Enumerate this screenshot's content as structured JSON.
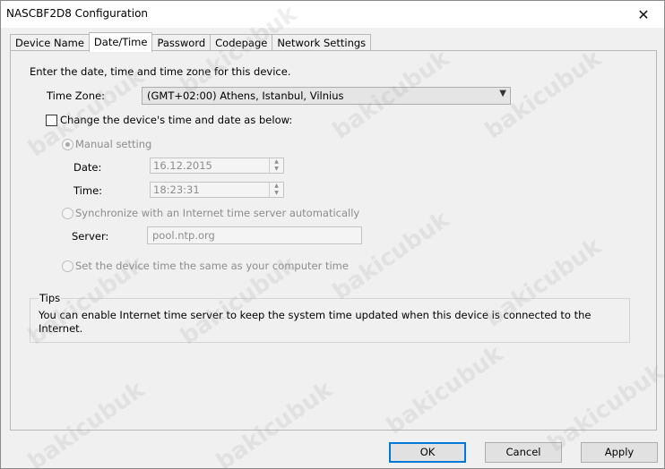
{
  "window": {
    "title": "NASCBF2D8 Configuration",
    "close_glyph": "✕"
  },
  "tabs": [
    {
      "label": "Device Name",
      "active": false
    },
    {
      "label": "Date/Time",
      "active": true
    },
    {
      "label": "Password",
      "active": false
    },
    {
      "label": "Codepage",
      "active": false
    },
    {
      "label": "Network Settings",
      "active": false
    }
  ],
  "content": {
    "intro": "Enter the date, time and time zone for this device.",
    "timezone_label": "Time Zone:",
    "timezone_value": "(GMT+02:00) Athens, Istanbul, Vilnius",
    "change_checkbox_label": "Change the device's time and date as below:",
    "change_checked": false,
    "manual_label": "Manual setting",
    "date_label": "Date:",
    "date_value": "16.12.2015",
    "time_label": "Time:",
    "time_value": "18:23:31",
    "sync_label": "Synchronize with an Internet time server automatically",
    "server_label": "Server:",
    "server_value": "pool.ntp.org",
    "same_label": "Set the device time the same as your computer time",
    "tips_title": "Tips",
    "tips_text": "You can enable Internet time server to keep the system time updated when this device is connected to the Internet."
  },
  "buttons": {
    "ok": "OK",
    "cancel": "Cancel",
    "apply": "Apply"
  },
  "watermark": "bakicubuk"
}
